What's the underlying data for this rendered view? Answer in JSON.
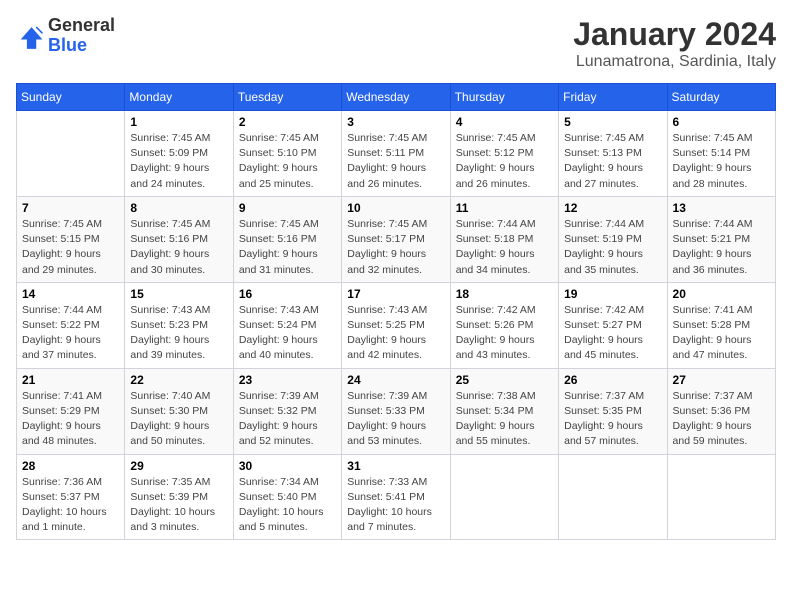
{
  "header": {
    "logo_general": "General",
    "logo_blue": "Blue",
    "title": "January 2024",
    "location": "Lunamatrona, Sardinia, Italy"
  },
  "weekdays": [
    "Sunday",
    "Monday",
    "Tuesday",
    "Wednesday",
    "Thursday",
    "Friday",
    "Saturday"
  ],
  "weeks": [
    [
      {
        "day": "",
        "sunrise": "",
        "sunset": "",
        "daylight": ""
      },
      {
        "day": "1",
        "sunrise": "Sunrise: 7:45 AM",
        "sunset": "Sunset: 5:09 PM",
        "daylight": "Daylight: 9 hours and 24 minutes."
      },
      {
        "day": "2",
        "sunrise": "Sunrise: 7:45 AM",
        "sunset": "Sunset: 5:10 PM",
        "daylight": "Daylight: 9 hours and 25 minutes."
      },
      {
        "day": "3",
        "sunrise": "Sunrise: 7:45 AM",
        "sunset": "Sunset: 5:11 PM",
        "daylight": "Daylight: 9 hours and 26 minutes."
      },
      {
        "day": "4",
        "sunrise": "Sunrise: 7:45 AM",
        "sunset": "Sunset: 5:12 PM",
        "daylight": "Daylight: 9 hours and 26 minutes."
      },
      {
        "day": "5",
        "sunrise": "Sunrise: 7:45 AM",
        "sunset": "Sunset: 5:13 PM",
        "daylight": "Daylight: 9 hours and 27 minutes."
      },
      {
        "day": "6",
        "sunrise": "Sunrise: 7:45 AM",
        "sunset": "Sunset: 5:14 PM",
        "daylight": "Daylight: 9 hours and 28 minutes."
      }
    ],
    [
      {
        "day": "7",
        "sunrise": "Sunrise: 7:45 AM",
        "sunset": "Sunset: 5:15 PM",
        "daylight": "Daylight: 9 hours and 29 minutes."
      },
      {
        "day": "8",
        "sunrise": "Sunrise: 7:45 AM",
        "sunset": "Sunset: 5:16 PM",
        "daylight": "Daylight: 9 hours and 30 minutes."
      },
      {
        "day": "9",
        "sunrise": "Sunrise: 7:45 AM",
        "sunset": "Sunset: 5:16 PM",
        "daylight": "Daylight: 9 hours and 31 minutes."
      },
      {
        "day": "10",
        "sunrise": "Sunrise: 7:45 AM",
        "sunset": "Sunset: 5:17 PM",
        "daylight": "Daylight: 9 hours and 32 minutes."
      },
      {
        "day": "11",
        "sunrise": "Sunrise: 7:44 AM",
        "sunset": "Sunset: 5:18 PM",
        "daylight": "Daylight: 9 hours and 34 minutes."
      },
      {
        "day": "12",
        "sunrise": "Sunrise: 7:44 AM",
        "sunset": "Sunset: 5:19 PM",
        "daylight": "Daylight: 9 hours and 35 minutes."
      },
      {
        "day": "13",
        "sunrise": "Sunrise: 7:44 AM",
        "sunset": "Sunset: 5:21 PM",
        "daylight": "Daylight: 9 hours and 36 minutes."
      }
    ],
    [
      {
        "day": "14",
        "sunrise": "Sunrise: 7:44 AM",
        "sunset": "Sunset: 5:22 PM",
        "daylight": "Daylight: 9 hours and 37 minutes."
      },
      {
        "day": "15",
        "sunrise": "Sunrise: 7:43 AM",
        "sunset": "Sunset: 5:23 PM",
        "daylight": "Daylight: 9 hours and 39 minutes."
      },
      {
        "day": "16",
        "sunrise": "Sunrise: 7:43 AM",
        "sunset": "Sunset: 5:24 PM",
        "daylight": "Daylight: 9 hours and 40 minutes."
      },
      {
        "day": "17",
        "sunrise": "Sunrise: 7:43 AM",
        "sunset": "Sunset: 5:25 PM",
        "daylight": "Daylight: 9 hours and 42 minutes."
      },
      {
        "day": "18",
        "sunrise": "Sunrise: 7:42 AM",
        "sunset": "Sunset: 5:26 PM",
        "daylight": "Daylight: 9 hours and 43 minutes."
      },
      {
        "day": "19",
        "sunrise": "Sunrise: 7:42 AM",
        "sunset": "Sunset: 5:27 PM",
        "daylight": "Daylight: 9 hours and 45 minutes."
      },
      {
        "day": "20",
        "sunrise": "Sunrise: 7:41 AM",
        "sunset": "Sunset: 5:28 PM",
        "daylight": "Daylight: 9 hours and 47 minutes."
      }
    ],
    [
      {
        "day": "21",
        "sunrise": "Sunrise: 7:41 AM",
        "sunset": "Sunset: 5:29 PM",
        "daylight": "Daylight: 9 hours and 48 minutes."
      },
      {
        "day": "22",
        "sunrise": "Sunrise: 7:40 AM",
        "sunset": "Sunset: 5:30 PM",
        "daylight": "Daylight: 9 hours and 50 minutes."
      },
      {
        "day": "23",
        "sunrise": "Sunrise: 7:39 AM",
        "sunset": "Sunset: 5:32 PM",
        "daylight": "Daylight: 9 hours and 52 minutes."
      },
      {
        "day": "24",
        "sunrise": "Sunrise: 7:39 AM",
        "sunset": "Sunset: 5:33 PM",
        "daylight": "Daylight: 9 hours and 53 minutes."
      },
      {
        "day": "25",
        "sunrise": "Sunrise: 7:38 AM",
        "sunset": "Sunset: 5:34 PM",
        "daylight": "Daylight: 9 hours and 55 minutes."
      },
      {
        "day": "26",
        "sunrise": "Sunrise: 7:37 AM",
        "sunset": "Sunset: 5:35 PM",
        "daylight": "Daylight: 9 hours and 57 minutes."
      },
      {
        "day": "27",
        "sunrise": "Sunrise: 7:37 AM",
        "sunset": "Sunset: 5:36 PM",
        "daylight": "Daylight: 9 hours and 59 minutes."
      }
    ],
    [
      {
        "day": "28",
        "sunrise": "Sunrise: 7:36 AM",
        "sunset": "Sunset: 5:37 PM",
        "daylight": "Daylight: 10 hours and 1 minute."
      },
      {
        "day": "29",
        "sunrise": "Sunrise: 7:35 AM",
        "sunset": "Sunset: 5:39 PM",
        "daylight": "Daylight: 10 hours and 3 minutes."
      },
      {
        "day": "30",
        "sunrise": "Sunrise: 7:34 AM",
        "sunset": "Sunset: 5:40 PM",
        "daylight": "Daylight: 10 hours and 5 minutes."
      },
      {
        "day": "31",
        "sunrise": "Sunrise: 7:33 AM",
        "sunset": "Sunset: 5:41 PM",
        "daylight": "Daylight: 10 hours and 7 minutes."
      },
      {
        "day": "",
        "sunrise": "",
        "sunset": "",
        "daylight": ""
      },
      {
        "day": "",
        "sunrise": "",
        "sunset": "",
        "daylight": ""
      },
      {
        "day": "",
        "sunrise": "",
        "sunset": "",
        "daylight": ""
      }
    ]
  ]
}
